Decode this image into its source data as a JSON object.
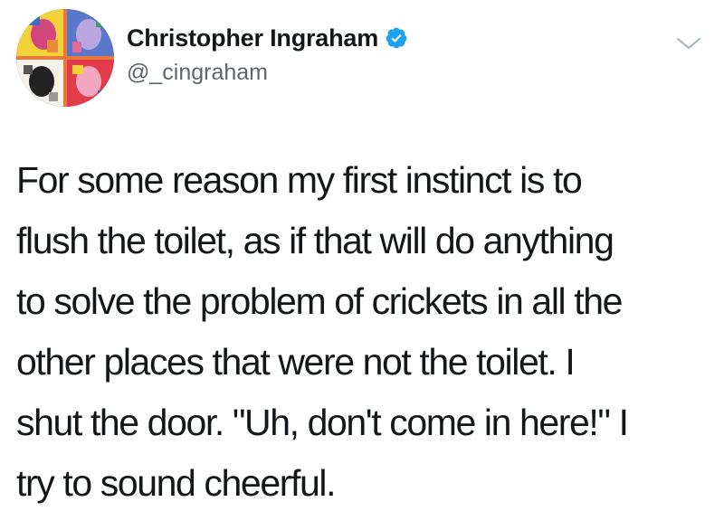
{
  "author": {
    "display_name": "Christopher Ingraham",
    "handle": "@_cingraham",
    "verified": true,
    "avatar_icon": "pop-art-quad-portrait"
  },
  "menu": {
    "icon": "chevron-down-icon",
    "color": "#aab8c2"
  },
  "tweet": {
    "lines": [
      "For some reason my first instinct is to",
      "flush the toilet, as if that will do anything",
      "to solve the problem of crickets in all the",
      "other places that were not the toilet. I",
      "shut the door. \"Uh, don't come in here!\" I",
      "try to sound cheerful."
    ]
  },
  "colors": {
    "text": "#14171a",
    "secondary_text": "#5b6670",
    "verified_badge": "#1da1f2",
    "background": "#ffffff"
  }
}
